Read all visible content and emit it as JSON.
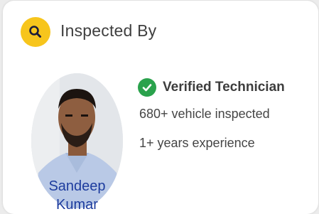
{
  "card": {
    "title": "Inspected By",
    "icon": "search-icon"
  },
  "inspector": {
    "name": "Sandeep Kumar",
    "badge_label": "Verified Technician",
    "badge_icon": "check-circle-icon",
    "vehicles_inspected": "680+ vehicle inspected",
    "experience": "1+ years experience"
  },
  "colors": {
    "accent_yellow": "#f7c51c",
    "verified_green": "#2aa24c",
    "name_blue": "#1d3c9e"
  }
}
